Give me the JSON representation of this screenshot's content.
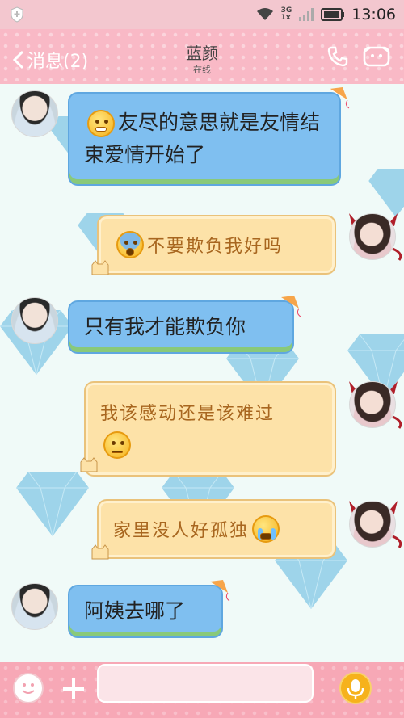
{
  "status_bar": {
    "time": "13:06",
    "network_top": "3G",
    "network_bottom": "1x"
  },
  "header": {
    "back_label": "消息(2)",
    "contact_name": "蓝颜",
    "presence": "在线"
  },
  "messages": [
    {
      "side": "left",
      "text": "友尽的意思就是友情结束爱情开始了",
      "emoji": "grinning-emoji"
    },
    {
      "side": "right",
      "text": "不要欺负我好吗",
      "emoji": "fearful-emoji"
    },
    {
      "side": "left",
      "text": "只有我才能欺负你"
    },
    {
      "side": "right",
      "text": "我该感动还是该难过",
      "emoji": "unamused-emoji"
    },
    {
      "side": "right",
      "text": "家里没人好孤独",
      "emoji": "crying-emoji"
    },
    {
      "side": "left",
      "text": "阿姨去哪了"
    }
  ],
  "input": {
    "value": "",
    "placeholder": ""
  },
  "colors": {
    "header": "#f9b9c6",
    "left_bubble": "#7fbff0",
    "right_bubble": "#fde2a8",
    "right_text": "#a8661f"
  }
}
